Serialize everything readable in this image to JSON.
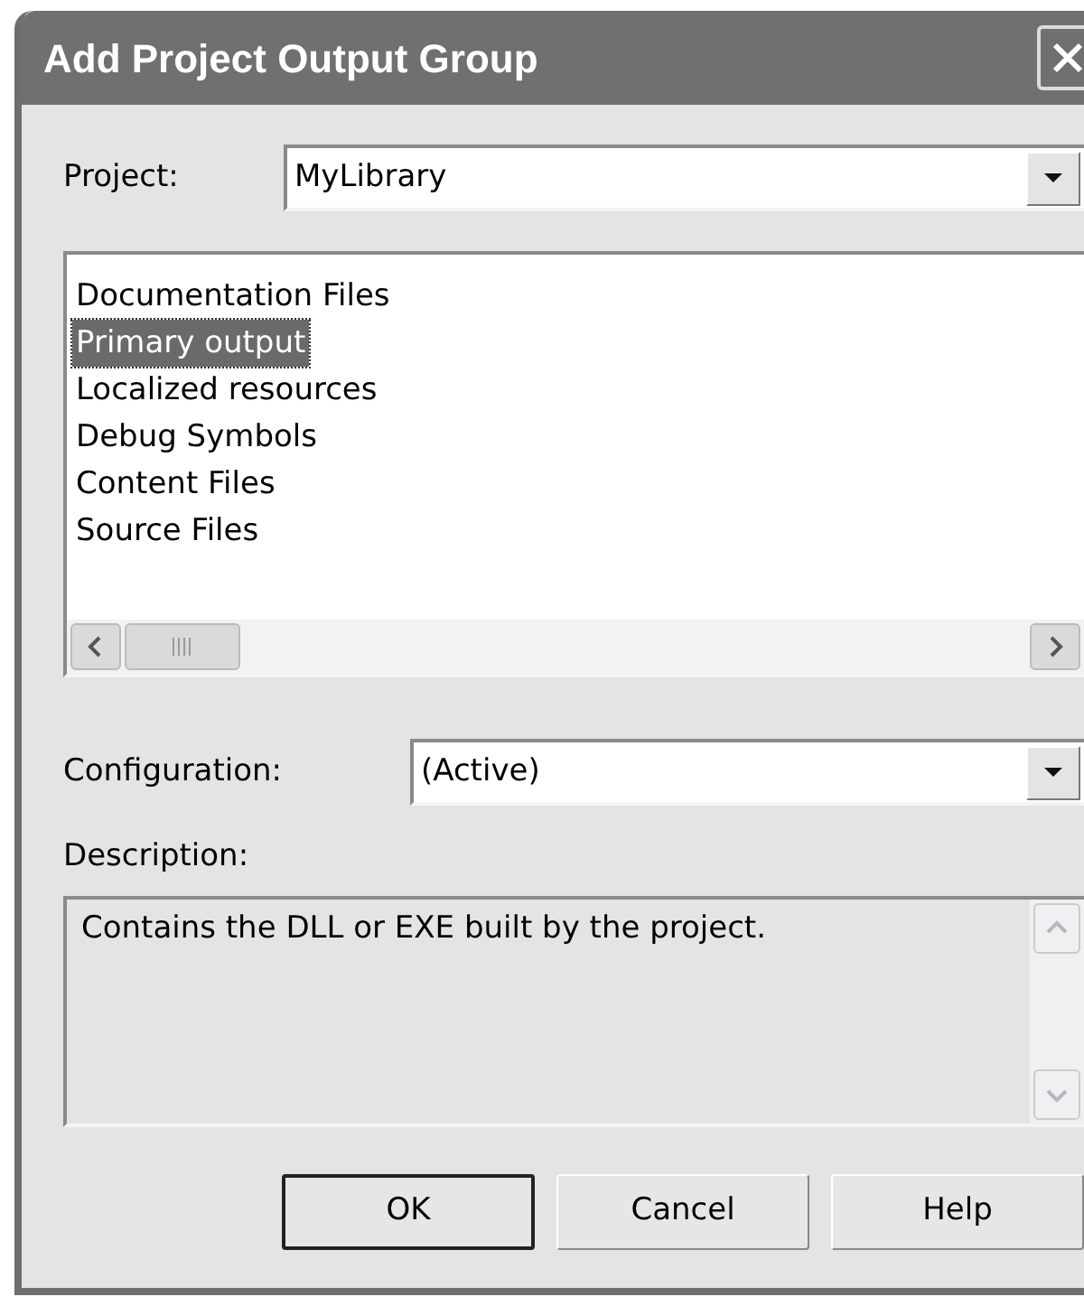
{
  "window": {
    "title": "Add Project Output Group"
  },
  "project": {
    "label": "Project:",
    "value": "MyLibrary"
  },
  "outputs": [
    {
      "label": "Documentation Files",
      "selected": false
    },
    {
      "label": "Primary output",
      "selected": true
    },
    {
      "label": "Localized resources",
      "selected": false
    },
    {
      "label": "Debug Symbols",
      "selected": false
    },
    {
      "label": "Content Files",
      "selected": false
    },
    {
      "label": "Source Files",
      "selected": false
    }
  ],
  "configuration": {
    "label": "Configuration:",
    "value": "(Active)"
  },
  "description": {
    "label": "Description:",
    "text": "Contains the DLL or EXE built by the project."
  },
  "buttons": [
    {
      "label": "OK",
      "default": true
    },
    {
      "label": "Cancel",
      "default": false
    },
    {
      "label": "Help",
      "default": false
    }
  ]
}
